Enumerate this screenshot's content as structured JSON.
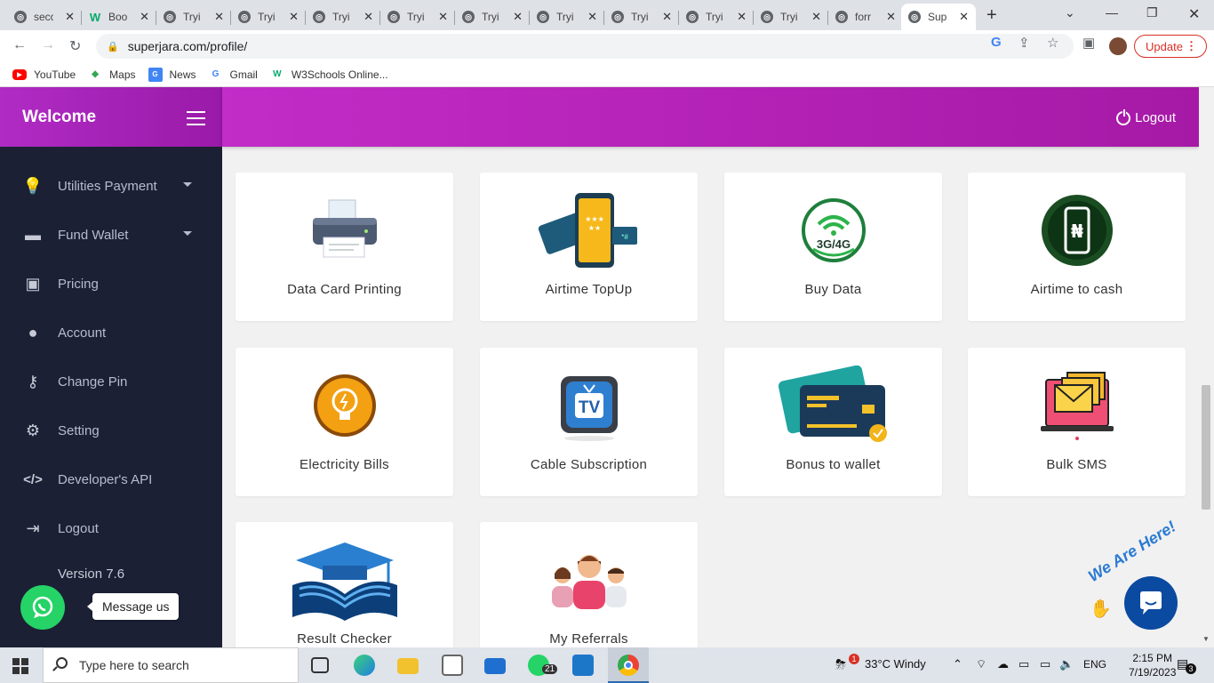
{
  "browser": {
    "tabs": [
      {
        "title": "seco",
        "icon": "globe-icon"
      },
      {
        "title": "Boo",
        "icon": "w3schools-icon"
      },
      {
        "title": "Tryi",
        "icon": "globe-icon"
      },
      {
        "title": "Tryi",
        "icon": "globe-icon"
      },
      {
        "title": "Tryi",
        "icon": "globe-icon"
      },
      {
        "title": "Tryi",
        "icon": "globe-icon"
      },
      {
        "title": "Tryi",
        "icon": "globe-icon"
      },
      {
        "title": "Tryi",
        "icon": "globe-icon"
      },
      {
        "title": "Tryi",
        "icon": "globe-icon"
      },
      {
        "title": "Tryi",
        "icon": "globe-icon"
      },
      {
        "title": "Tryi",
        "icon": "globe-icon"
      },
      {
        "title": "forr",
        "icon": "globe-icon"
      },
      {
        "title": "Sup",
        "icon": "globe-icon",
        "active": true
      }
    ],
    "url": "superjara.com/profile/",
    "update_label": "Update",
    "bookmarks": [
      "YouTube",
      "Maps",
      "News",
      "Gmail",
      "W3Schools Online..."
    ]
  },
  "app": {
    "brand": "Welcome",
    "logout_top": "Logout",
    "menu": [
      {
        "label": "Utilities Payment",
        "icon": "bulb-icon",
        "dropdown": true
      },
      {
        "label": "Fund Wallet",
        "icon": "credit-card-icon",
        "dropdown": true
      },
      {
        "label": "Pricing",
        "icon": "money-icon",
        "dropdown": false
      },
      {
        "label": "Account",
        "icon": "user-icon",
        "dropdown": false
      },
      {
        "label": "Change Pin",
        "icon": "key-icon",
        "dropdown": false
      },
      {
        "label": "Setting",
        "icon": "gear-icon",
        "dropdown": false
      },
      {
        "label": "Developer's API",
        "icon": "code-icon",
        "dropdown": false
      },
      {
        "label": "Logout",
        "icon": "sign-out-icon",
        "dropdown": false
      }
    ],
    "version": "Version 7.6",
    "services": [
      {
        "label": "Data Card Printing",
        "icon": "printer-icon"
      },
      {
        "label": "Airtime TopUp",
        "icon": "phone-topup-icon"
      },
      {
        "label": "Buy Data",
        "icon": "wifi-3g4g-icon"
      },
      {
        "label": "Airtime to cash",
        "icon": "naira-phone-icon"
      },
      {
        "label": "Electricity Bills",
        "icon": "lightbulb-icon"
      },
      {
        "label": "Cable Subscription",
        "icon": "tv-icon"
      },
      {
        "label": "Bonus to wallet",
        "icon": "bank-card-icon"
      },
      {
        "label": "Bulk SMS",
        "icon": "envelopes-laptop-icon"
      },
      {
        "label": "Result Checker",
        "icon": "graduation-book-icon"
      },
      {
        "label": "My Referrals",
        "icon": "people-icon"
      }
    ],
    "whatsapp_label": "Message us",
    "chat_widget_text": "We Are Here!",
    "tv_text": "TV",
    "data_text": "3G/4G",
    "naira_symbol": "₦"
  },
  "taskbar": {
    "search_placeholder": "Type here to search",
    "whatsapp_badge": "21",
    "weather_badge": "1",
    "weather": "33°C  Windy",
    "language": "ENG",
    "time": "2:15 PM",
    "date": "7/19/2023",
    "notifications": "3"
  },
  "colors": {
    "sidebar": "#1c2035",
    "header_gradient_start": "#c22cc7",
    "header_gradient_end": "#a619a6",
    "whatsapp": "#25d366"
  }
}
